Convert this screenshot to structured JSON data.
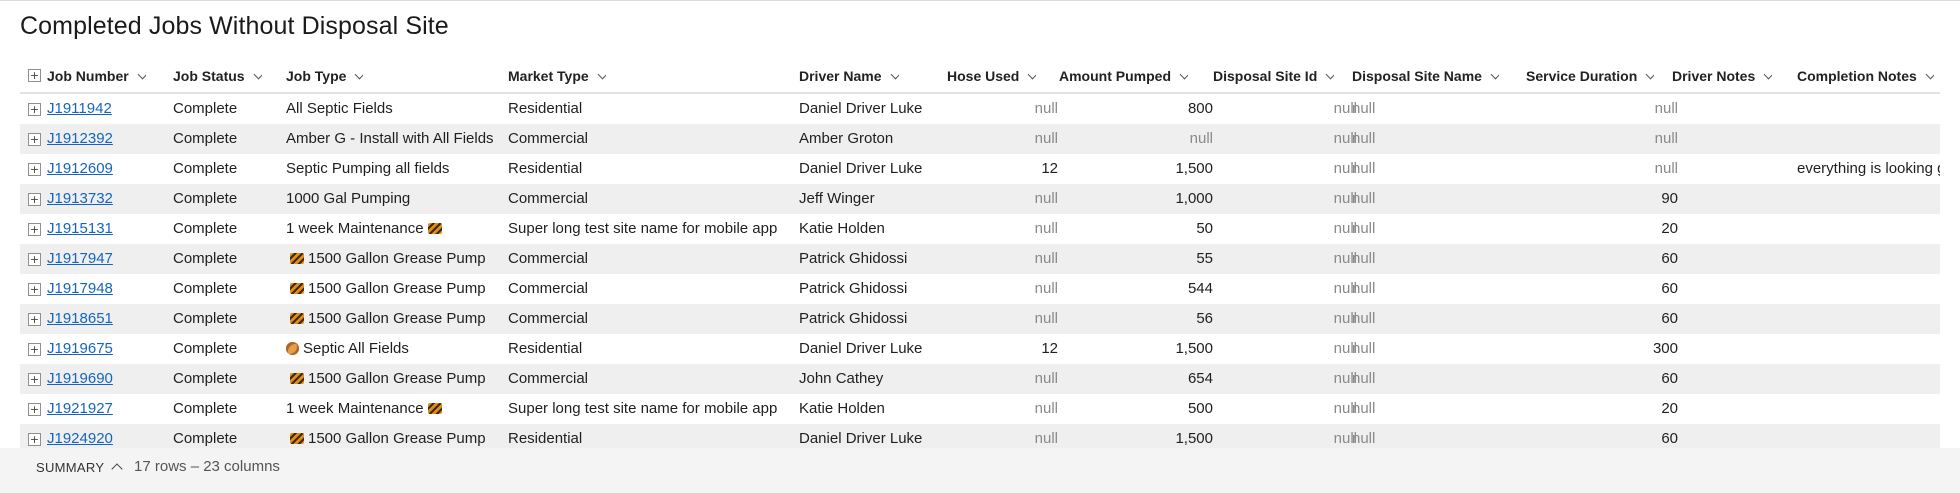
{
  "title": "Completed Jobs Without Disposal Site",
  "columns": [
    "Job Number",
    "Job Status",
    "Job Type",
    "Market Type",
    "Driver Name",
    "Hose Used",
    "Amount Pumped",
    "Disposal Site Id",
    "Disposal Site Name",
    "Service Duration",
    "Driver Notes",
    "Completion Notes"
  ],
  "rows": [
    {
      "job": "J1911942",
      "status": "Complete",
      "type": "All Septic Fields",
      "type_icon": "",
      "market": " Residential",
      "driver": "Daniel Driver Luke",
      "hose": "null",
      "amount": "800",
      "site_id": "null",
      "site_name": "null",
      "duration": "null",
      "driver_notes": "",
      "completion": ""
    },
    {
      "job": "J1912392",
      "status": "Complete",
      "type": "Amber G - Install with All Fields",
      "type_icon": "",
      "market": "Commercial",
      "driver": "Amber Groton",
      "hose": "null",
      "amount": "null",
      "site_id": "null",
      "site_name": "null",
      "duration": "null",
      "driver_notes": "",
      "completion": ""
    },
    {
      "job": "J1912609",
      "status": "Complete",
      "type": "Septic Pumping all fields",
      "type_icon": "",
      "market": " Residential",
      "driver": "Daniel Driver Luke",
      "hose": "12",
      "amount": "1,500",
      "site_id": "null",
      "site_name": "null",
      "duration": "null",
      "driver_notes": "",
      "completion": "everything is looking g"
    },
    {
      "job": "J1913732",
      "status": "Complete",
      "type": "1000 Gal Pumping",
      "type_icon": "",
      "market": "Commercial",
      "driver": "Jeff Winger",
      "hose": "null",
      "amount": "1,000",
      "site_id": "null",
      "site_name": "null",
      "duration": "90",
      "driver_notes": "",
      "completion": ""
    },
    {
      "job": "J1915131",
      "status": "Complete",
      "type": "1 week Maintenance",
      "type_icon": "cone-after",
      "market": "Super long test site name for mobile app",
      "driver": "Katie Holden",
      "hose": "null",
      "amount": "50",
      "site_id": "null",
      "site_name": "null",
      "duration": "20",
      "driver_notes": "",
      "completion": ""
    },
    {
      "job": "J1917947",
      "status": "Complete",
      "type": "1500 Gallon Grease Pump",
      "type_icon": "cone-before",
      "market": "Commercial",
      "driver": "Patrick Ghidossi",
      "hose": "null",
      "amount": "55",
      "site_id": "null",
      "site_name": "null",
      "duration": "60",
      "driver_notes": "",
      "completion": ""
    },
    {
      "job": "J1917948",
      "status": "Complete",
      "type": "1500 Gallon Grease Pump",
      "type_icon": "cone-before",
      "market": "Commercial",
      "driver": "Patrick Ghidossi",
      "hose": "null",
      "amount": "544",
      "site_id": "null",
      "site_name": "null",
      "duration": "60",
      "driver_notes": "",
      "completion": ""
    },
    {
      "job": "J1918651",
      "status": "Complete",
      "type": "1500 Gallon Grease Pump",
      "type_icon": "cone-before",
      "market": "Commercial",
      "driver": "Patrick Ghidossi",
      "hose": "null",
      "amount": "56",
      "site_id": "null",
      "site_name": "null",
      "duration": "60",
      "driver_notes": "",
      "completion": ""
    },
    {
      "job": "J1919675",
      "status": "Complete",
      "type": "Septic All Fields",
      "type_icon": "cookie-before",
      "market": " Residential",
      "driver": "Daniel Driver Luke",
      "hose": "12",
      "amount": "1,500",
      "site_id": "null",
      "site_name": "null",
      "duration": "300",
      "driver_notes": "",
      "completion": ""
    },
    {
      "job": "J1919690",
      "status": "Complete",
      "type": "1500 Gallon Grease Pump",
      "type_icon": "cone-before",
      "market": "Commercial",
      "driver": "John Cathey",
      "hose": "null",
      "amount": "654",
      "site_id": "null",
      "site_name": "null",
      "duration": "60",
      "driver_notes": "",
      "completion": ""
    },
    {
      "job": "J1921927",
      "status": "Complete",
      "type": "1 week Maintenance",
      "type_icon": "cone-after",
      "market": "Super long test site name for mobile app",
      "driver": "Katie Holden",
      "hose": "null",
      "amount": "500",
      "site_id": "null",
      "site_name": "null",
      "duration": "20",
      "driver_notes": "",
      "completion": ""
    },
    {
      "job": "J1924920",
      "status": "Complete",
      "type": "1500 Gallon Grease Pump",
      "type_icon": "cone-before",
      "market": " Residential",
      "driver": "Daniel Driver Luke",
      "hose": "null",
      "amount": "1,500",
      "site_id": "null",
      "site_name": "null",
      "duration": "60",
      "driver_notes": "",
      "completion": ""
    }
  ],
  "summary": {
    "label": "SUMMARY",
    "count": "17 rows – 23 columns"
  },
  "colors": {
    "link": "#1565c0",
    "null_text": "#8a8a8a",
    "row_alt": "#efefef"
  }
}
